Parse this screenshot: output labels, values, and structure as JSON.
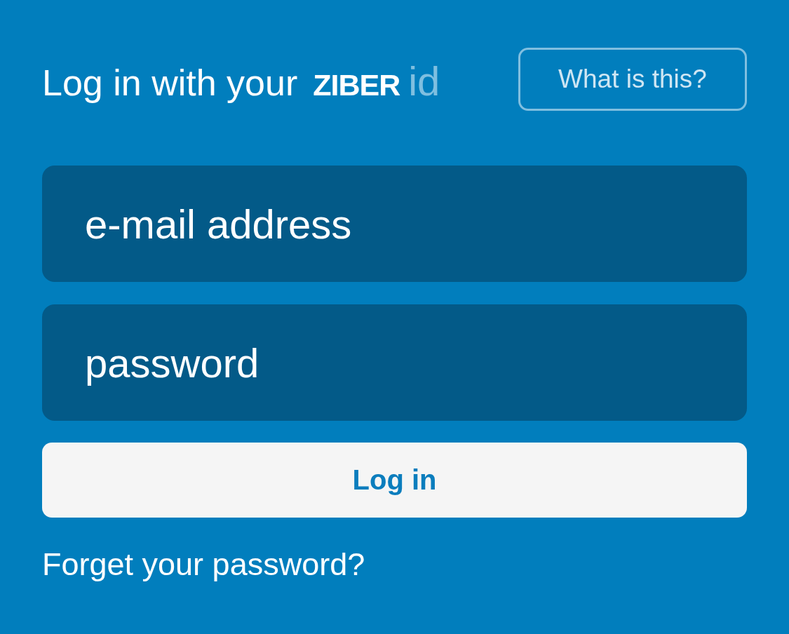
{
  "header": {
    "title": "Log in with your",
    "brand": "ZIBER",
    "brand_suffix": "id",
    "help_button": "What is this?"
  },
  "email_field": {
    "placeholder": "e-mail address"
  },
  "password_field": {
    "placeholder": "password"
  },
  "submit_button": "Log in",
  "forgot_link": "Forget your password?"
}
